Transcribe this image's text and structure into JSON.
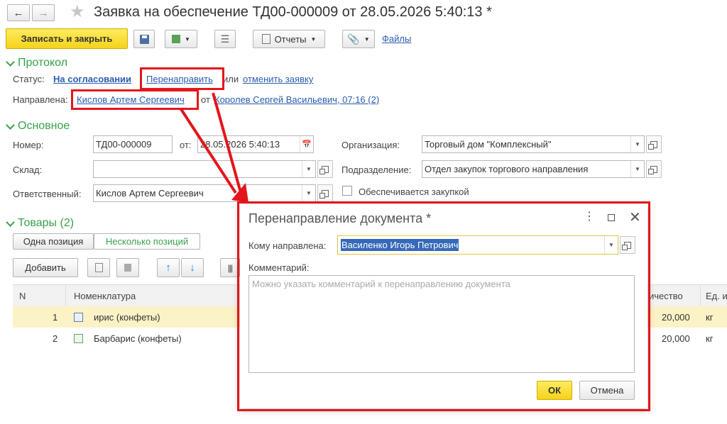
{
  "window": {
    "title": "Заявка на обеспечение ТД00-000009 от 28.05.2026 5:40:13 *"
  },
  "toolbar": {
    "save_close": "Записать и закрыть",
    "reports": "Отчеты",
    "files": "Файлы"
  },
  "protocol": {
    "title": "Протокол",
    "status_label": "Статус:",
    "status_value": "На согласовании",
    "redirect_link": "Перенаправить",
    "or_text": "или",
    "cancel_link": "отменить заявку",
    "directed_label": "Направлена:",
    "directed_to": "Кислов Артем Сергеевич",
    "from_text": "от",
    "directed_from": "Королев Сергей Васильевич, 07:16 (2)"
  },
  "main": {
    "title": "Основное",
    "number_label": "Номер:",
    "number_value": "ТД00-000009",
    "date_label": "от:",
    "date_value": "28.05.2026  5:40:13",
    "warehouse_label": "Склад:",
    "warehouse_value": "",
    "responsible_label": "Ответственный:",
    "responsible_value": "Кислов Артем Сергеевич",
    "org_label": "Организация:",
    "org_value": "Торговый дом \"Комплексный\"",
    "division_label": "Подразделение:",
    "division_value": "Отдел закупок торгового направления",
    "procurement_label": "Обеспечивается закупкой"
  },
  "goods": {
    "title": "Товары (2)",
    "tab_one": "Одна позиция",
    "tab_many": "Несколько позиций",
    "add_button": "Добавить",
    "columns": {
      "n": "N",
      "nomenclature": "Номенклатура",
      "quantity": "ичество",
      "unit": "Ед. и"
    },
    "rows": [
      {
        "n": "1",
        "name": "ирис (конфеты)",
        "qty": "20,000",
        "unit": "кг"
      },
      {
        "n": "2",
        "name": "Барбарис (конфеты)",
        "qty": "20,000",
        "unit": "кг"
      }
    ]
  },
  "dialog": {
    "title": "Перенаправление документа *",
    "to_label": "Кому направлена:",
    "to_value": "Василенко Игорь Петрович",
    "comment_label": "Комментарий:",
    "comment_placeholder": "Можно указать комментарий к перенаправлению документа",
    "ok": "ОК",
    "cancel": "Отмена"
  },
  "colors": {
    "accent_green": "#3aa14a",
    "link_blue": "#2a5db0",
    "highlight_red": "#e3161c",
    "button_yellow": "#f7dd2c",
    "row_selected": "#fbf2c6"
  }
}
